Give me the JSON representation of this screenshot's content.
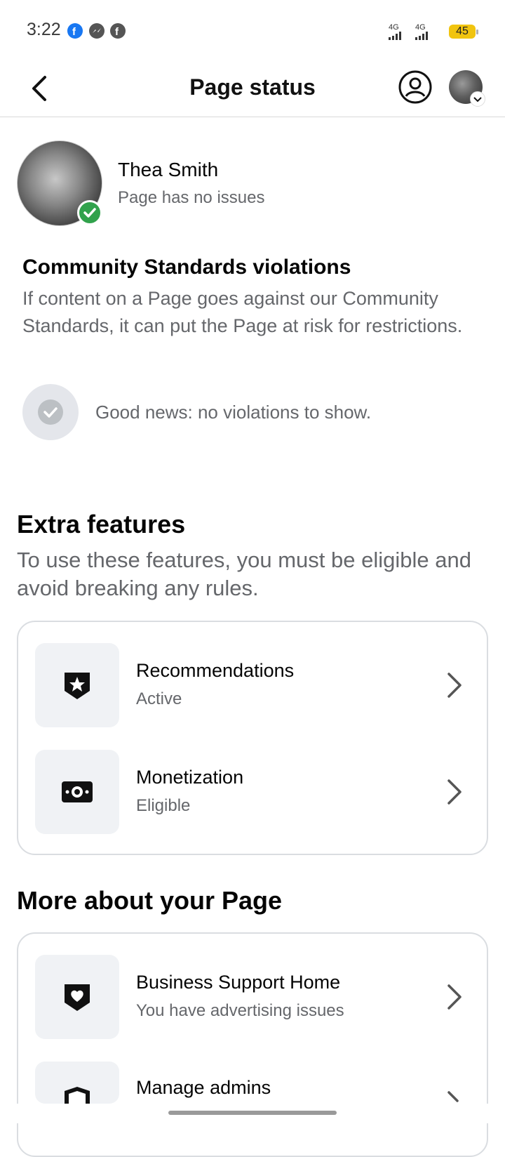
{
  "status_bar": {
    "time": "3:22",
    "network_1": "4G",
    "network_2": "4G",
    "battery": "45",
    "icons": [
      "facebook-icon",
      "messenger-icon",
      "facebook-icon"
    ]
  },
  "header": {
    "title": "Page status",
    "icons": [
      "back-arrow-icon",
      "profile-icon",
      "chevron-down-icon"
    ]
  },
  "page": {
    "name": "Thea Smith",
    "status": "Page has no issues"
  },
  "community_standards": {
    "title": "Community Standards violations",
    "description": "If content on a Page goes against our Community Standards, it can put the Page at risk for restrictions.",
    "empty_message": "Good news: no violations to show."
  },
  "extra_features": {
    "title": "Extra features",
    "description": "To use these features, you must be eligible and avoid breaking any rules.",
    "items": [
      {
        "title": "Recommendations",
        "subtitle": "Active",
        "icon": "star-shield-icon"
      },
      {
        "title": "Monetization",
        "subtitle": "Eligible",
        "icon": "money-icon"
      }
    ]
  },
  "more_about": {
    "title": "More about your Page",
    "items": [
      {
        "title": "Business Support Home",
        "subtitle": "You have advertising issues",
        "icon": "heart-shield-icon"
      },
      {
        "title": "Manage admins",
        "subtitle": "",
        "icon": "shield-icon"
      }
    ]
  },
  "colors": {
    "success": "#31a24c",
    "secondary_text": "#65676b",
    "tile_bg": "#f0f2f5",
    "battery": "#f1c40f"
  }
}
